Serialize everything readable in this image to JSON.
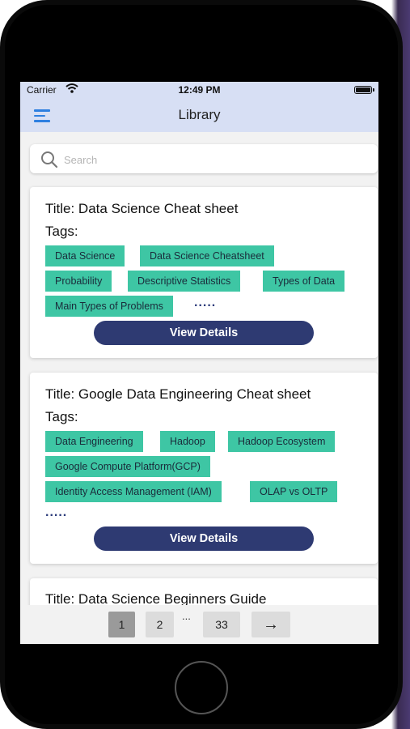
{
  "status_bar": {
    "carrier": "Carrier",
    "time": "12:49 PM"
  },
  "nav": {
    "title": "Library"
  },
  "search": {
    "placeholder": "Search"
  },
  "cards": [
    {
      "title": "Title: Data Science Cheat sheet",
      "tags_label": "Tags:",
      "tags": [
        "Data Science",
        "Data Science Cheatsheet",
        "Probability",
        "Descriptive Statistics",
        "Types of Data",
        "Main Types of Problems"
      ],
      "more": ".....",
      "button": "View Details"
    },
    {
      "title": "Title: Google Data Engineering Cheat sheet",
      "tags_label": "Tags:",
      "tags": [
        "Data Engineering",
        "Hadoop",
        "Hadoop Ecosystem",
        "Google Compute Platform(GCP)",
        "Identity Access Management (IAM)",
        "OLAP vs OLTP"
      ],
      "more": ".....",
      "button": "View Details"
    },
    {
      "title": "Title: Data Science Beginners Guide"
    }
  ],
  "pagination": {
    "pages": [
      "1",
      "2",
      "33"
    ],
    "dots": "...",
    "next": "→",
    "current": "1"
  },
  "colors": {
    "header": "#d7dff4",
    "tag": "#3ec6a4",
    "button": "#2e3a72",
    "menu_icon": "#2d7fe0"
  }
}
